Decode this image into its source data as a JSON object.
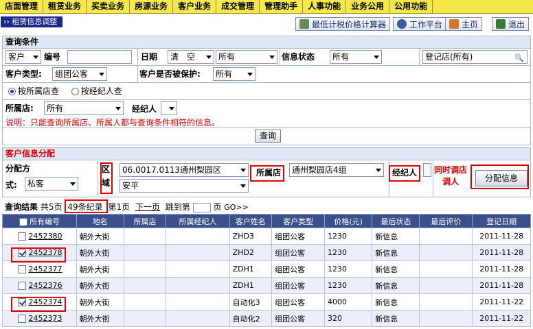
{
  "menu": [
    "店面管理",
    "租赁业务",
    "买卖业务",
    "房源业务",
    "客户业务",
    "成交管理",
    "管理助手",
    "人事功能",
    "业务公用",
    "公用功能"
  ],
  "page_title": "›› 租赁信息调整",
  "toolbar": {
    "calc": "最低计税价格计算器",
    "workbench": "工作平台",
    "home": "主页",
    "exit": "退出"
  },
  "query": {
    "header": "查询条件",
    "customer_select": "客户",
    "id_label": "编号",
    "date_label": "日期",
    "date_clear": "清　空",
    "date_option": "所有",
    "status_label": "信息状态",
    "status_option": "所有",
    "store_select": "登记店(所有)",
    "ctype_label": "客户类型:",
    "ctype_option": "组团公客",
    "protect_label": "客户是否被保护:",
    "protect_option": "所有",
    "radio1": "按所属店查",
    "radio2": "按经纪人查",
    "belong_store_label": "所属店:",
    "belong_store_option": "所有",
    "agent_label": "经纪人",
    "note": "说明：只能查询所属店、所属人都与查询条件相符的信息。",
    "query_button": "查询"
  },
  "assign": {
    "header": "客户信息分配",
    "method_label1": "分配方",
    "method_label2": "式:",
    "method_option": "私客",
    "area_label1": "区",
    "area_label2": "域",
    "area_option1": "06.0017.0113通州梨园区",
    "area_option2": "安平",
    "store_label": "所属店",
    "store_option": "通州梨园店4组",
    "agent_label": "经纪人",
    "transfer_label1": "同时调店",
    "transfer_label2": "调人",
    "assign_button": "分配信息"
  },
  "result": {
    "label": "查询结果",
    "total_prefix": "共5页",
    "records": "49条纪录",
    "page_info": "第1页",
    "next_page": "下一页",
    "jump_label": "跳到第",
    "page_unit": "页",
    "go": "GO>>"
  },
  "table": {
    "columns": [
      "所有编号",
      "地名",
      "所属店",
      "所属经纪人",
      "客户姓名",
      "客户类型",
      "价格(元)",
      "最后状态",
      "最后评价",
      "登记日期"
    ],
    "rows": [
      {
        "checked": false,
        "id": "2452380",
        "place": "朝外大街",
        "store": "",
        "agent": "",
        "name": "ZHD3",
        "type": "组团公客",
        "price": "1230",
        "status": "新信息",
        "eval": "",
        "date": "2011-11-28"
      },
      {
        "checked": true,
        "id": "2452378",
        "place": "朝外大街",
        "store": "",
        "agent": "",
        "name": "ZHD2",
        "type": "组团公客",
        "price": "1230",
        "status": "新信息",
        "eval": "",
        "date": "2011-11-28"
      },
      {
        "checked": false,
        "id": "2452377",
        "place": "朝外大街",
        "store": "",
        "agent": "",
        "name": "ZDH1",
        "type": "组团公客",
        "price": "1230",
        "status": "新信息",
        "eval": "",
        "date": "2011-11-28"
      },
      {
        "checked": false,
        "id": "2452376",
        "place": "朝外大街",
        "store": "",
        "agent": "",
        "name": "ZDH1",
        "type": "组团公客",
        "price": "1230",
        "status": "新信息",
        "eval": "",
        "date": "2011-11-28"
      },
      {
        "checked": true,
        "id": "2452374",
        "place": "朝外大街",
        "store": "",
        "agent": "",
        "name": "自动化3",
        "type": "组团公客",
        "price": "4000",
        "status": "新信息",
        "eval": "",
        "date": "2011-11-22"
      },
      {
        "checked": false,
        "id": "2452373",
        "place": "朝外大街",
        "store": "",
        "agent": "",
        "name": "自动化2",
        "type": "组团公客",
        "price": "320",
        "status": "新信息",
        "eval": "",
        "date": "2011-11-22"
      }
    ]
  },
  "colors": {
    "menu_bg": "#f7e84a",
    "title_bg": "#1a2a8a",
    "table_header": "#3a4f8c",
    "highlight": "#e00000"
  }
}
